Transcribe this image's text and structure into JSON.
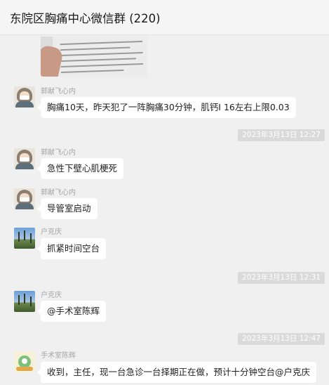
{
  "header": {
    "title": "东院区胸痛中心微信群 (220)"
  },
  "messages": [
    {
      "sender": "郭献飞心内",
      "text": "胸痛10天，昨天犯了一阵胸痛30分钟，肌钙I  16左右上限0.03"
    },
    {
      "sender": "郭献飞心内",
      "text": "急性下壁心肌梗死"
    },
    {
      "sender": "郭献飞心内",
      "text": "导管室启动"
    },
    {
      "sender": "户克庆",
      "text": "抓紧时间空台"
    },
    {
      "sender": "户克庆",
      "text": "@手术室陈辉"
    },
    {
      "sender": "手术室陈辉",
      "text": "收到，主任，现一台急诊一台择期正在做，预计十分钟空台@户克庆"
    }
  ],
  "timestamps": [
    "2023年3月13日 12:27",
    "2023年3月13日 12:31",
    "2023年3月13日 12:47"
  ],
  "icons": {
    "doctor_avatar": "doctor-avatar-icon",
    "landscape_avatar": "landscape-avatar-icon",
    "cartoon_avatar": "cartoon-avatar-icon"
  }
}
